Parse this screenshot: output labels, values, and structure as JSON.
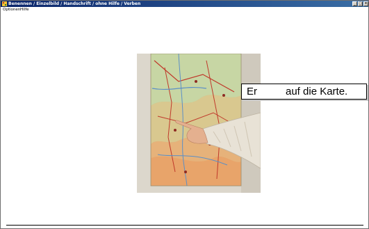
{
  "window": {
    "title": "Benennen / Einzelbild / Handschrift / ohne Hilfe / Verben",
    "minimize_label": "_",
    "maximize_label": "□",
    "close_label": "×"
  },
  "menu": {
    "items": [
      {
        "label": "Optionen"
      },
      {
        "label": "Hilfe"
      }
    ]
  },
  "exercise": {
    "sentence_start": "Er",
    "sentence_end": "auf die Karte."
  },
  "colors": {
    "titlebar": "#0a246a",
    "window_bg": "#ffffff",
    "photo_wall": "#dcd7cc",
    "map_green": "#b7c993",
    "map_orange": "#e6b27a",
    "sweater": "#e8e2d6"
  }
}
